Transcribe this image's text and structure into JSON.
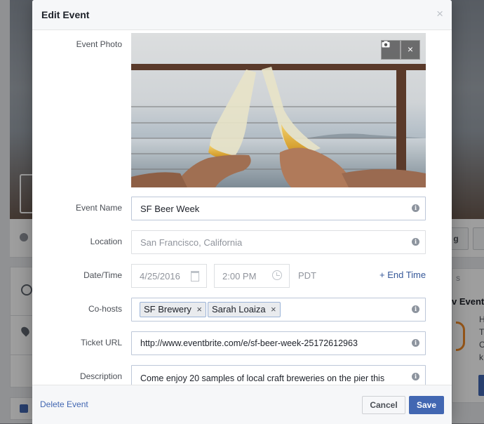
{
  "modal": {
    "title": "Edit Event",
    "close": "×"
  },
  "labels": {
    "photo": "Event Photo",
    "name": "Event Name",
    "location": "Location",
    "datetime": "Date/Time",
    "cohosts": "Co-hosts",
    "ticket": "Ticket URL",
    "description": "Description"
  },
  "photo": {
    "camera_icon": "camera-icon",
    "remove": "×"
  },
  "fields": {
    "name_value": "SF Beer Week",
    "location_placeholder": "San Francisco, California",
    "date_value": "4/25/2016",
    "time_value": "2:00 PM",
    "timezone": "PDT",
    "end_time_link": "+ End Time",
    "cohosts": [
      {
        "name": "SF Brewery"
      },
      {
        "name": "Sarah Loaiza"
      }
    ],
    "ticket_url": "http://www.eventbrite.com/e/sf-beer-week-25172612963",
    "description": "Come enjoy 20 samples of local craft breweries on the pier this"
  },
  "footer": {
    "delete_label": "Delete Event",
    "cancel_label": "Cancel",
    "save_label": "Save"
  },
  "background": {
    "button_partial": "g",
    "side_title": "s",
    "side_heading": "v Event",
    "side_lines": [
      "H",
      "T",
      "C",
      "k"
    ]
  },
  "colors": {
    "accent": "#4267b2",
    "link": "#365899",
    "header_bg": "#f6f7f9"
  }
}
